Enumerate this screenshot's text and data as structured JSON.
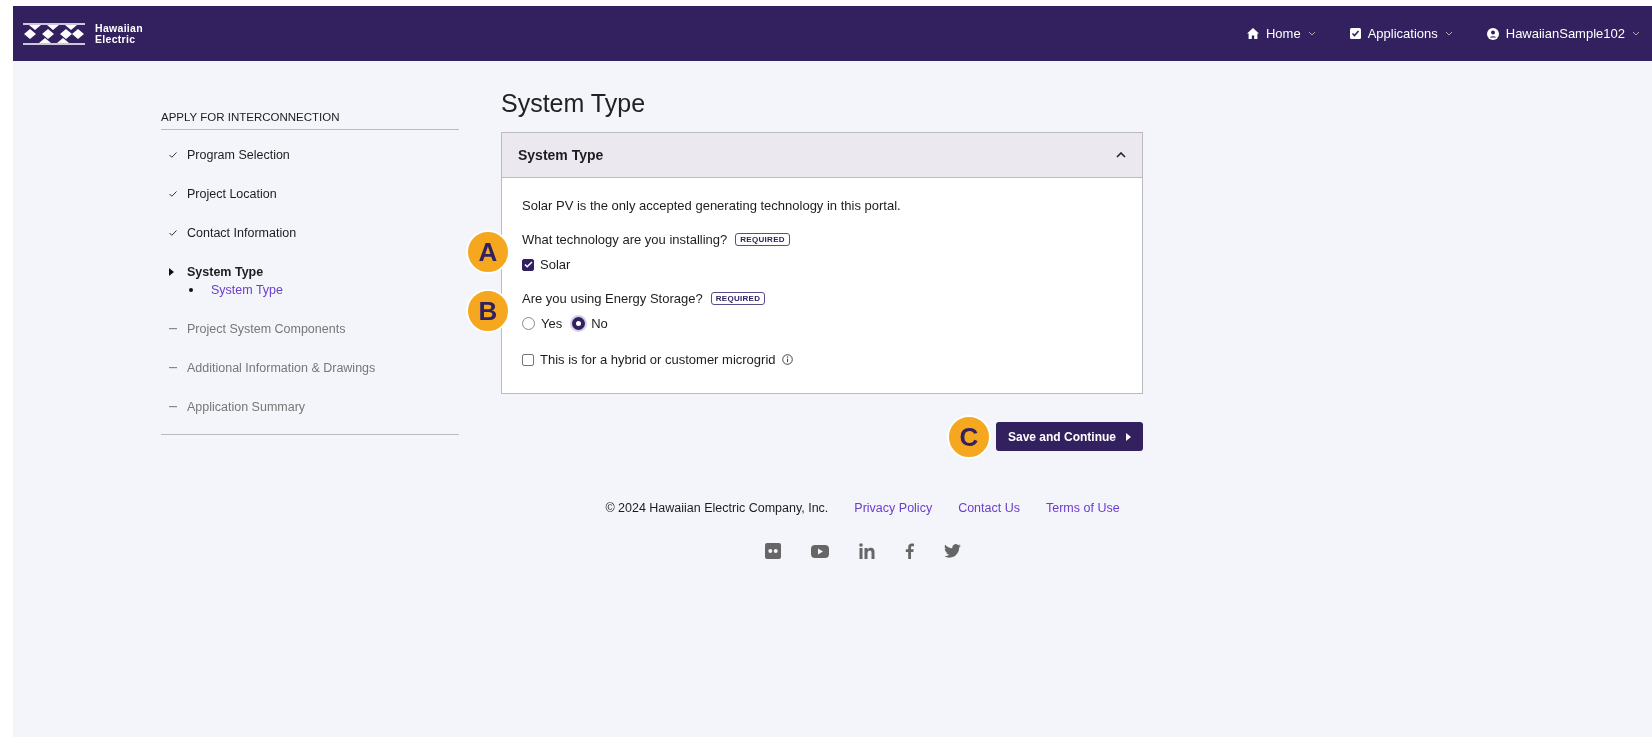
{
  "header": {
    "logo_lines": [
      "Hawaiian",
      "Electric"
    ],
    "nav": [
      {
        "label": "Home",
        "kind": "home"
      },
      {
        "label": "Applications",
        "kind": "checkbox"
      },
      {
        "label": "HawaiianSample102",
        "kind": "user"
      }
    ]
  },
  "sidebar": {
    "heading": "APPLY FOR INTERCONNECTION",
    "steps": [
      {
        "label": "Program Selection",
        "kind": "done"
      },
      {
        "label": "Project Location",
        "kind": "done"
      },
      {
        "label": "Contact Information",
        "kind": "done"
      },
      {
        "label": "System Type",
        "kind": "current",
        "children": [
          {
            "label": "System Type",
            "selected": true
          }
        ]
      },
      {
        "label": "Project System Components",
        "kind": "pending"
      },
      {
        "label": "Additional Information & Drawings",
        "kind": "pending"
      },
      {
        "label": "Application Summary",
        "kind": "pending"
      }
    ]
  },
  "page_title": "System Type",
  "panel": {
    "title": "System Type",
    "expanded": true,
    "intro": "Solar PV is the only accepted generating technology in this portal.",
    "questions": [
      {
        "kind": "checkbox",
        "label": "What technology are you installing?",
        "badge": "REQUIRED",
        "callout": "A",
        "options": [
          {
            "label": "Solar",
            "checked": true
          }
        ]
      },
      {
        "kind": "radio",
        "label": "Are you using Energy Storage?",
        "badge": "REQUIRED",
        "callout": "B",
        "options": [
          {
            "label": "Yes",
            "selected": false
          },
          {
            "label": "No",
            "selected": true
          }
        ]
      }
    ],
    "microgrid": {
      "label": "This is for a hybrid or customer microgrid",
      "checked": false
    }
  },
  "save_button": {
    "label": "Save and Continue",
    "callout": "C"
  },
  "footer": {
    "copyright": "© 2024 Hawaiian Electric Company, Inc.",
    "links": [
      "Privacy Policy",
      "Contact Us",
      "Terms of Use"
    ],
    "social": [
      {
        "kind": "flickr"
      },
      {
        "kind": "youtube"
      },
      {
        "kind": "linkedin"
      },
      {
        "kind": "facebook"
      },
      {
        "kind": "twitter"
      }
    ]
  }
}
